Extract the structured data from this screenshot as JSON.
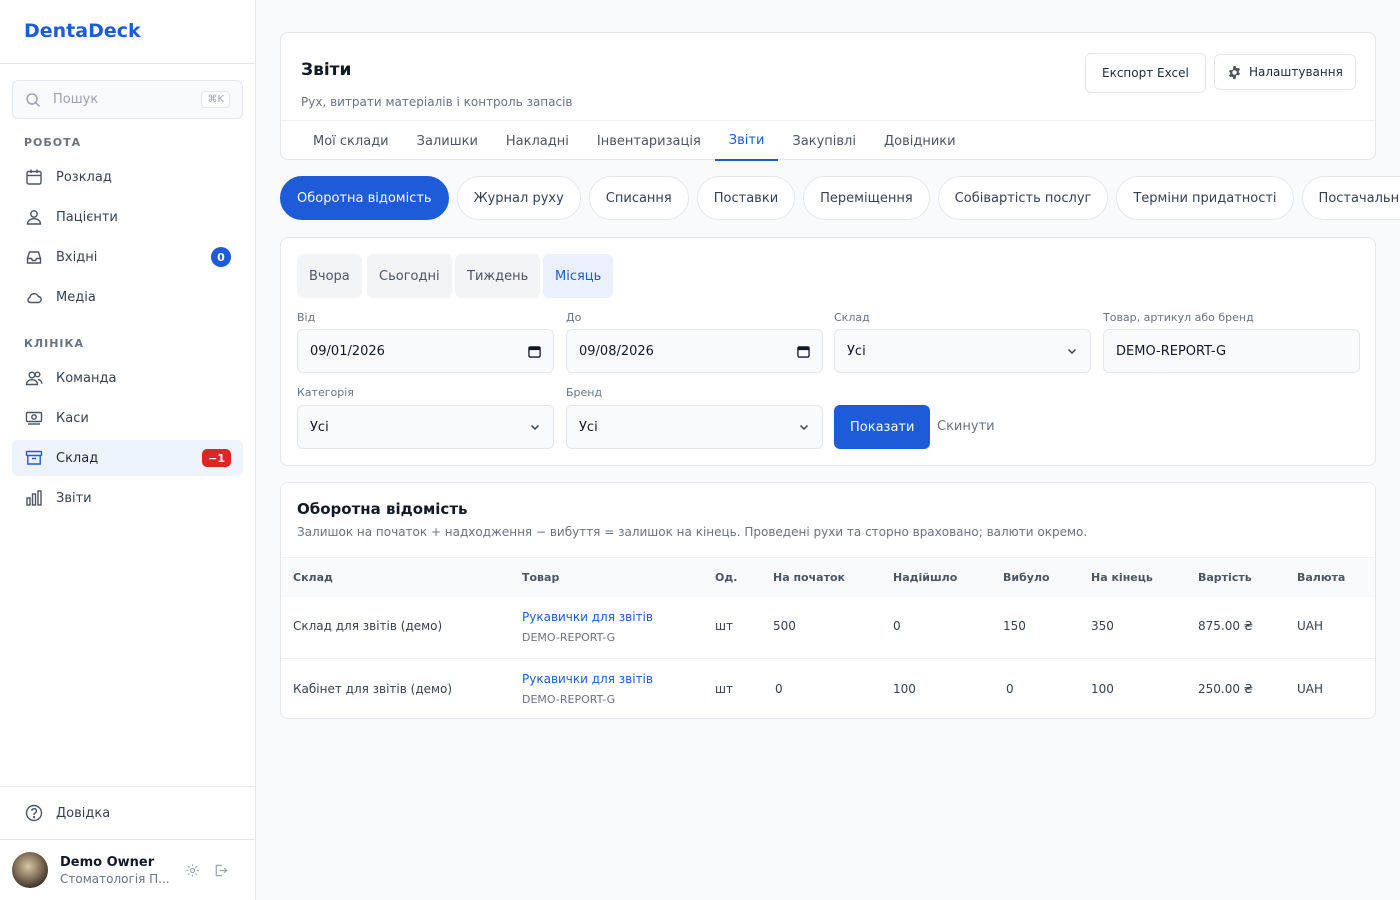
{
  "app": {
    "name": "DentaDeck"
  },
  "sidebar": {
    "search": {
      "placeholder": "Пошук",
      "shortcut": "⌘K"
    },
    "sections": [
      {
        "label": "РОБОТА"
      },
      {
        "label": "КЛІНІКА"
      }
    ],
    "items": [
      {
        "label": "Розклад",
        "icon": "calendar-icon"
      },
      {
        "label": "Пацієнти",
        "icon": "user-icon"
      },
      {
        "label": "Вхідні",
        "icon": "inbox-icon",
        "badge": "0"
      },
      {
        "label": "Медіа",
        "icon": "cloud-icon"
      },
      {
        "label": "Команда",
        "icon": "team-icon"
      },
      {
        "label": "Каси",
        "icon": "cash-register-icon"
      },
      {
        "label": "Склад",
        "icon": "archive-box-icon",
        "badge": "−1",
        "active": true
      },
      {
        "label": "Звіти",
        "icon": "bar-chart-icon"
      }
    ],
    "help": {
      "label": "Довідка"
    },
    "user": {
      "name": "Demo Owner",
      "org": "Стоматологія П..."
    }
  },
  "header": {
    "title": "Звіти",
    "subtitle": "Рух, витрати матеріалів і контроль запасів",
    "export_label": "Експорт Excel",
    "settings_label": "Налаштування",
    "tabs": [
      "Мої склади",
      "Залишки",
      "Накладні",
      "Інвентаризація",
      "Звіти",
      "Закупівлі",
      "Довідники"
    ],
    "active_tab": "Звіти"
  },
  "report_types": [
    "Оборотна відомість",
    "Журнал руху",
    "Списання",
    "Поставки",
    "Переміщення",
    "Собівартість послуг",
    "Терміни придатності",
    "Постачальники"
  ],
  "active_report": "Оборотна відомість",
  "filters": {
    "quick": [
      "Вчора",
      "Сьогодні",
      "Тиждень",
      "Місяць"
    ],
    "active_quick": "Місяць",
    "from": {
      "label": "Від",
      "value": "09/01/2026"
    },
    "to": {
      "label": "До",
      "value": "09/08/2026"
    },
    "warehouse": {
      "label": "Склад",
      "value": "Усі"
    },
    "product": {
      "label": "Товар, артикул або бренд",
      "value": "DEMO-REPORT-G"
    },
    "category": {
      "label": "Категорія",
      "value": "Усі"
    },
    "brand": {
      "label": "Бренд",
      "value": "Усі"
    },
    "show_label": "Показати",
    "reset_label": "Скинути"
  },
  "report": {
    "title": "Оборотна відомість",
    "description": "Залишок на початок + надходження − вибуття = залишок на кінець. Проведені рухи та сторно враховано; валюти окремо.",
    "columns": [
      "Склад",
      "Товар",
      "Од.",
      "На початок",
      "Надійшло",
      "Вибуло",
      "На кінець",
      "Вартість",
      "Валюта"
    ],
    "rows": [
      {
        "warehouse": "Склад для звітів (демо)",
        "product": "Рукавички для звітів",
        "sku": "DEMO-REPORT-G",
        "unit": "шт",
        "start": "500",
        "in": "0",
        "out": "150",
        "end": "350",
        "value": "875.00 ₴",
        "currency": "UAH"
      },
      {
        "warehouse": "Кабінет для звітів (демо)",
        "product": "Рукавички для звітів",
        "sku": "DEMO-REPORT-G",
        "unit": "шт",
        "start": "0",
        "in": "100",
        "out": "0",
        "end": "100",
        "value": "250.00 ₴",
        "currency": "UAH"
      }
    ]
  }
}
